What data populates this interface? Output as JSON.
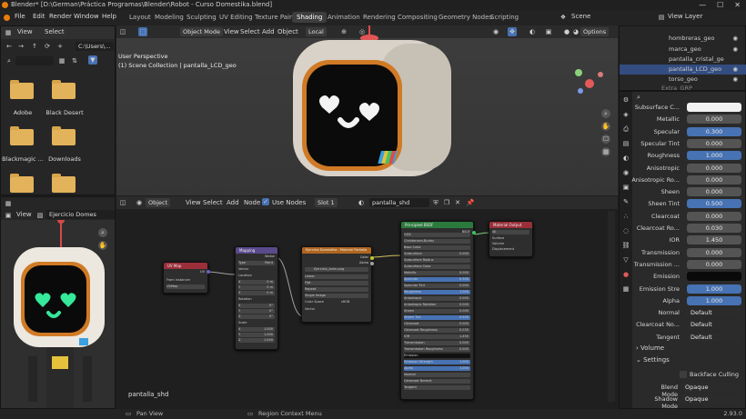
{
  "titlebar": {
    "title": "Blender* [D:\\German\\Práctica Programas\\Blender\\Robot - Curso Domestika.blend]",
    "minimize": "—",
    "maximize": "☐",
    "close": "✕"
  },
  "menubar": {
    "items": [
      "File",
      "Edit",
      "Render",
      "Window",
      "Help"
    ]
  },
  "workspaces": [
    "Layout",
    "Modeling",
    "Sculpting",
    "UV Editing",
    "Texture Paint",
    "Shading",
    "Animation",
    "Rendering",
    "Compositing",
    "Geometry Nodes",
    "Scripting"
  ],
  "scene": {
    "label": "Scene",
    "view_layer": "View Layer"
  },
  "filebrowser": {
    "menus": [
      "View",
      "Select"
    ],
    "path": "C:\\Users\\...",
    "folders": [
      "Adobe",
      "Black Desert",
      "Blackmagic ...",
      "Downloads"
    ]
  },
  "viewport": {
    "mode": "Object Mode",
    "menus": [
      "View",
      "Select",
      "Add",
      "Object"
    ],
    "transform": "Local",
    "options": "Options",
    "info_line1": "User Perspective",
    "info_line2": "(1) Scene Collection | pantalla_LCD_geo"
  },
  "outliner": {
    "items": [
      {
        "name": "hombreras_geo",
        "active": false
      },
      {
        "name": "marca_geo",
        "active": false
      },
      {
        "name": "pantalla_cristal_ge",
        "active": false
      },
      {
        "name": "pantalla_LCD_geo",
        "active": true
      },
      {
        "name": "torso_geo",
        "active": false
      },
      {
        "name": "Extra_GRP",
        "active": false
      }
    ]
  },
  "properties": {
    "rows": [
      {
        "label": "Subsurface C...",
        "value": "",
        "style": "white"
      },
      {
        "label": "Metallic",
        "value": "0.000",
        "style": "gray"
      },
      {
        "label": "Specular",
        "value": "0.300",
        "style": "blue"
      },
      {
        "label": "Specular Tint",
        "value": "0.000",
        "style": "gray"
      },
      {
        "label": "Roughness",
        "value": "1.000",
        "style": "blue"
      },
      {
        "label": "Anisotropic",
        "value": "0.000",
        "style": "gray"
      },
      {
        "label": "Anisotropic Ro...",
        "value": "0.000",
        "style": "gray"
      },
      {
        "label": "Sheen",
        "value": "0.000",
        "style": "gray"
      },
      {
        "label": "Sheen Tint",
        "value": "0.500",
        "style": "blue"
      },
      {
        "label": "Clearcoat",
        "value": "0.000",
        "style": "gray"
      },
      {
        "label": "Clearcoat Ro...",
        "value": "0.030",
        "style": "gray"
      },
      {
        "label": "IOR",
        "value": "1.450",
        "style": "gray"
      },
      {
        "label": "Transmission",
        "value": "0.000",
        "style": "gray"
      },
      {
        "label": "Transmission ...",
        "value": "0.000",
        "style": "gray"
      },
      {
        "label": "Emission",
        "value": "",
        "style": "black"
      },
      {
        "label": "Emission Stre",
        "value": "1.000",
        "style": "blue"
      },
      {
        "label": "Alpha",
        "value": "1.000",
        "style": "blue"
      },
      {
        "label": "Normal",
        "value": "Default",
        "style": "dark"
      },
      {
        "label": "Clearcoat No...",
        "value": "Default",
        "style": "dark"
      },
      {
        "label": "Tangent",
        "value": "Default",
        "style": "dark"
      }
    ],
    "sections": [
      "Volume",
      "Settings"
    ],
    "backface": "Backface Culling",
    "blend_mode_label": "Blend Mode",
    "blend_mode": "Opaque",
    "shadow_mode_label": "Shadow Mode",
    "shadow_mode": "Opaque"
  },
  "image_editor": {
    "view": "View",
    "image_name": "Ejercicio Domes"
  },
  "node_editor": {
    "type": "Object",
    "menus": [
      "View",
      "Select",
      "Add",
      "Node"
    ],
    "use_nodes": "Use Nodes",
    "slot": "Slot 1",
    "material": "pantalla_shd",
    "footer_label": "pantalla_shd",
    "nodes": {
      "uvmap": {
        "title": "UV Map",
        "rows": [
          "UV",
          "From Instancer",
          "UVMap"
        ]
      },
      "mapping": {
        "title": "Mapping",
        "rows": [
          "Vector",
          "Type",
          "Point",
          "Vector",
          "Location",
          "X",
          "Y",
          "Z",
          "Rotation",
          "X",
          "Y",
          "Z",
          "Scale",
          "X",
          "Y",
          "Z"
        ],
        "values": [
          "0 m",
          "0 m",
          "0 m",
          "0°",
          "0°",
          "0°",
          "1.000",
          "1.000",
          "1.000"
        ]
      },
      "image": {
        "title": "Ejercicio Domestika - Material Pantalla",
        "rows": [
          "Color",
          "Alpha",
          "Ejercicio_Anim.png",
          "Linear",
          "Flat",
          "Repeat",
          "Single Image",
          "Color Space",
          "sRGB",
          "Vector"
        ]
      },
      "bsdf": {
        "title": "Principled BSDF",
        "rows": [
          "BSDF",
          "GGX",
          "Christensen-Burley",
          "Base Color",
          "Subsurface",
          "Subsurface Radius",
          "Subsurface Color",
          "Metallic",
          "Specular",
          "Specular Tint",
          "Roughness",
          "Anisotropic",
          "Anisotropic Rotation",
          "Sheen",
          "Sheen Tint",
          "Clearcoat",
          "Clearcoat Roughness",
          "IOR",
          "Transmission",
          "Transmission Roughness",
          "Emission",
          "Emission Strength",
          "Alpha",
          "Normal",
          "Clearcoat Normal",
          "Tangent"
        ],
        "values": [
          "0.000",
          "0.000",
          "0.300",
          "0.000",
          "1.000",
          "0.000",
          "0.000",
          "0.000",
          "0.500",
          "0.000",
          "0.030",
          "1.450",
          "0.000",
          "0.000",
          "1.000",
          "1.000"
        ]
      },
      "output": {
        "title": "Material Output",
        "rows": [
          "All",
          "Surface",
          "Volume",
          "Displacement"
        ]
      }
    }
  },
  "statusbar": {
    "pan": "Pan View",
    "context": "Region Context Menu",
    "version": "2.93.0"
  },
  "colors": {
    "accent": "#4772b3",
    "active_tab": "#3e3e3e",
    "orange": "#e87d0d",
    "folder": "#e2b35a",
    "emission_green": "#35e89a"
  }
}
